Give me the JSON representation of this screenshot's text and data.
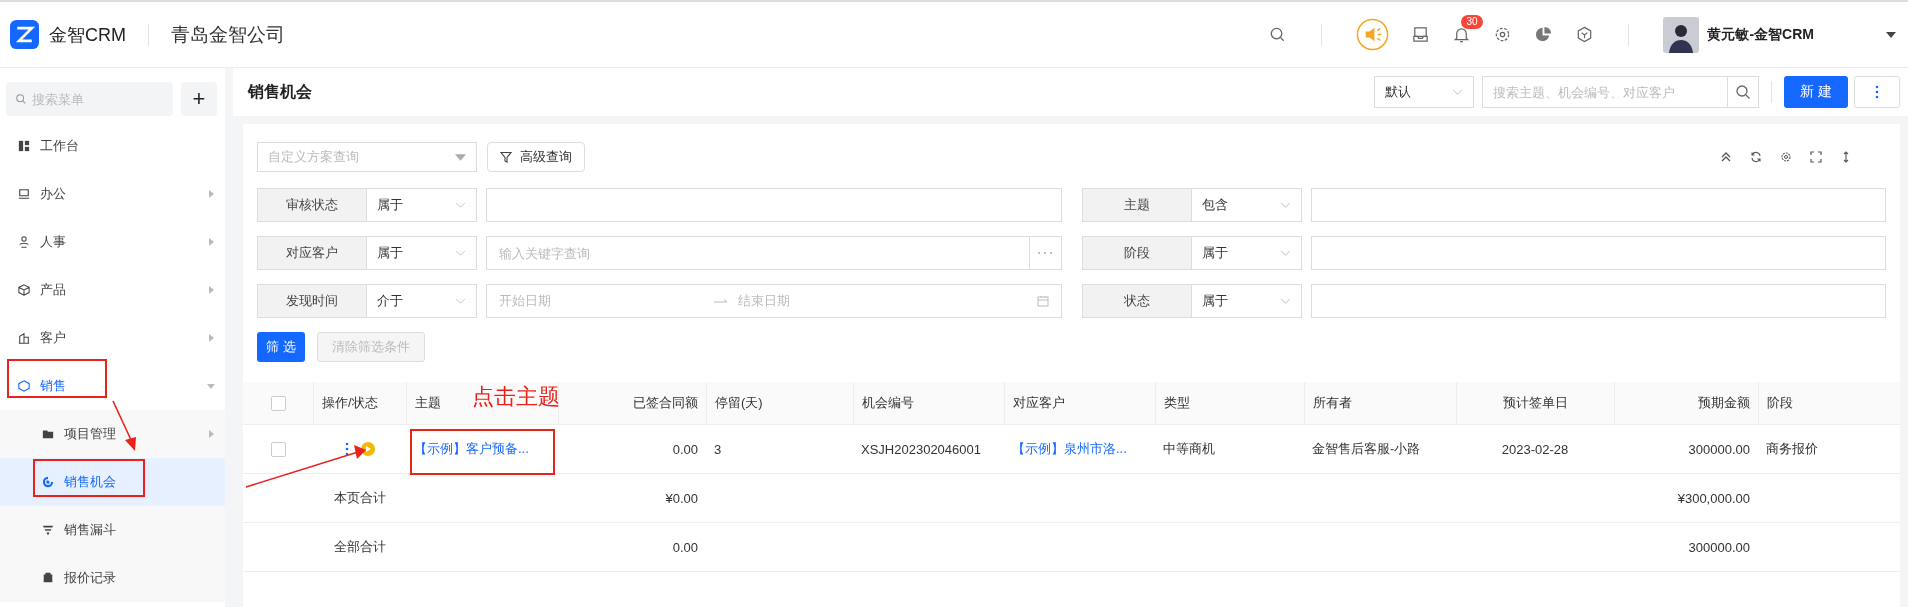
{
  "header": {
    "brand": "金智CRM",
    "company": "青岛金智公司",
    "notification_count": "30",
    "user": "黄元敏-金智CRM"
  },
  "sidebar": {
    "search_placeholder": "搜索菜单",
    "add_label": "+",
    "items": [
      {
        "label": "工作台",
        "kind": "link",
        "selected": false
      },
      {
        "label": "办公",
        "kind": "group",
        "expanded": false,
        "selected": false
      },
      {
        "label": "人事",
        "kind": "group",
        "expanded": false,
        "selected": false
      },
      {
        "label": "产品",
        "kind": "group",
        "expanded": false,
        "selected": false
      },
      {
        "label": "客户",
        "kind": "group",
        "expanded": false,
        "selected": false
      },
      {
        "label": "销售",
        "kind": "group",
        "expanded": true,
        "selected": true,
        "children": [
          {
            "label": "项目管理",
            "kind": "group",
            "expanded": false,
            "selected": false
          },
          {
            "label": "销售机会",
            "kind": "link",
            "selected": true
          },
          {
            "label": "销售漏斗",
            "kind": "link",
            "selected": false
          },
          {
            "label": "报价记录",
            "kind": "link",
            "selected": false
          }
        ]
      }
    ]
  },
  "page": {
    "title": "销售机会",
    "view_select": "默认",
    "search_placeholder": "搜索主题、机会编号、对应客户",
    "new_button": "新 建"
  },
  "filters": {
    "scheme_placeholder": "自定义方案查询",
    "advanced_button": "高级查询",
    "left": [
      {
        "label": "审核状态",
        "operator": "属于",
        "kind": "text"
      },
      {
        "label": "对应客户",
        "operator": "属于",
        "kind": "lookup",
        "placeholder": "输入关键字查询"
      },
      {
        "label": "发现时间",
        "operator": "介于",
        "kind": "date",
        "start_placeholder": "开始日期",
        "end_placeholder": "结束日期"
      }
    ],
    "right": [
      {
        "label": "主题",
        "operator": "包含",
        "kind": "text"
      },
      {
        "label": "阶段",
        "operator": "属于",
        "kind": "text"
      },
      {
        "label": "状态",
        "operator": "属于",
        "kind": "text"
      }
    ],
    "apply_button": "筛 选",
    "clear_button": {
      "label": "清除筛选条件",
      "disabled": true
    }
  },
  "table": {
    "all_checked": false,
    "columns": [
      "操作/状态",
      "主题",
      "已签合同额",
      "停留(天)",
      "机会编号",
      "对应客户",
      "类型",
      "所有者",
      "预计签单日",
      "预期金额",
      "阶段"
    ],
    "rows": [
      {
        "checked": false,
        "subject": "【示例】客户预备...",
        "signed_amount": "0.00",
        "stay_days": "3",
        "number": "XSJH202302046001",
        "customer": "【示例】泉州市洛...",
        "type": "中等商机",
        "owner": "金智售后客服-小路",
        "expected_date": "2023-02-28",
        "expected_amount": "300000.00",
        "stage": "商务报价"
      }
    ],
    "totals": [
      {
        "label": "本页合计",
        "signed_amount": "¥0.00",
        "expected_amount": "¥300,000.00"
      },
      {
        "label": "全部合计",
        "signed_amount": "0.00",
        "expected_amount": "300000.00"
      }
    ]
  },
  "annotation": {
    "text": "点击主题"
  }
}
